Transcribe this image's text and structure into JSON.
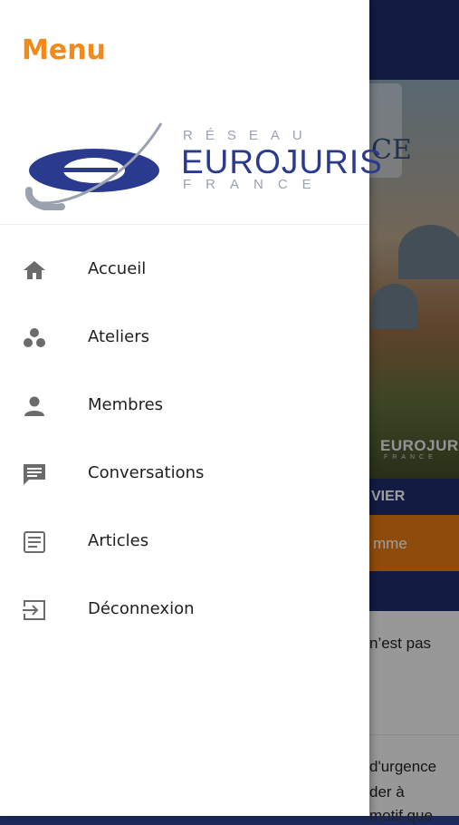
{
  "drawer": {
    "title": "Menu",
    "logo": {
      "line1": "RÉSEAU",
      "line2": "EUROJURIS",
      "line3": "FRANCE"
    },
    "items": [
      {
        "label": "Accueil",
        "icon": "home-icon"
      },
      {
        "label": "Ateliers",
        "icon": "workshops-icon"
      },
      {
        "label": "Membres",
        "icon": "person-icon"
      },
      {
        "label": "Conversations",
        "icon": "chat-icon"
      },
      {
        "label": "Articles",
        "icon": "article-icon"
      },
      {
        "label": "Déconnexion",
        "icon": "logout-icon"
      }
    ]
  },
  "background": {
    "hero_fragment": "CE",
    "hero_logo": "EUROJURIS",
    "hero_logo_sub": "FRANCE",
    "band_fragment": "VIER",
    "button_fragment": "mme",
    "text_line1": "n’est pas",
    "text_line2": "d'urgence",
    "text_line3": "der à",
    "text_line4": "motif que"
  },
  "colors": {
    "accent": "#f28a1b",
    "brand_blue": "#2a3a8f",
    "navy": "#1d2d6b",
    "orange": "#e67a13"
  }
}
